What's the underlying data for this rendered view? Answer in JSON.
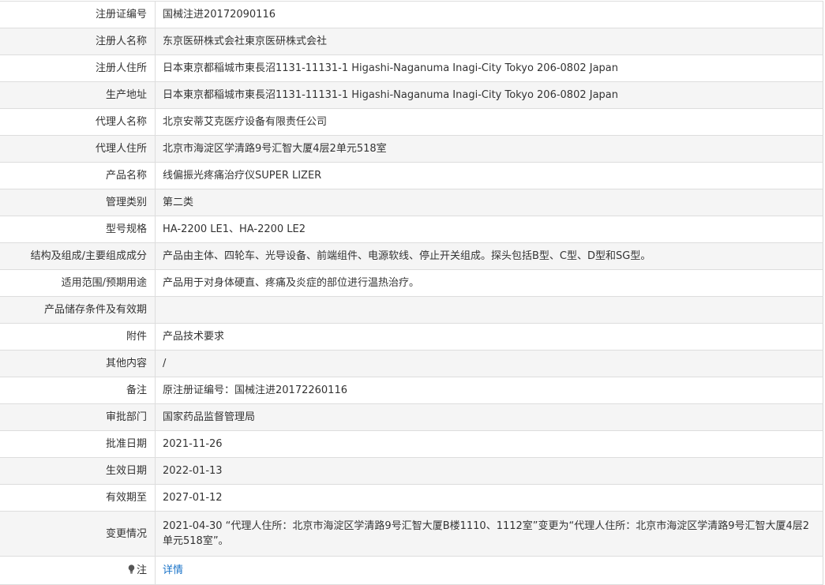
{
  "rows": [
    {
      "label": "注册证编号",
      "value": "国械注进20172090116"
    },
    {
      "label": "注册人名称",
      "value": "东京医研株式会社東京医研株式会社"
    },
    {
      "label": "注册人住所",
      "value": "日本東京都稲城市東長沼1131-11131-1 Higashi-Naganuma Inagi-City Tokyo 206-0802 Japan"
    },
    {
      "label": "生产地址",
      "value": "日本東京都稲城市東長沼1131-11131-1 Higashi-Naganuma Inagi-City Tokyo 206-0802 Japan"
    },
    {
      "label": "代理人名称",
      "value": "北京安蒂艾克医疗设备有限责任公司"
    },
    {
      "label": "代理人住所",
      "value": "北京市海淀区学清路9号汇智大厦4层2单元518室"
    },
    {
      "label": "产品名称",
      "value": "线偏振光疼痛治疗仪SUPER LIZER"
    },
    {
      "label": "管理类别",
      "value": "第二类"
    },
    {
      "label": "型号规格",
      "value": "HA-2200 LE1、HA-2200 LE2"
    },
    {
      "label": "结构及组成/主要组成成分",
      "value": "产品由主体、四轮车、光导设备、前端组件、电源软线、停止开关组成。探头包括B型、C型、D型和SG型。"
    },
    {
      "label": "适用范围/预期用途",
      "value": "产品用于对身体硬直、疼痛及炎症的部位进行温热治疗。"
    },
    {
      "label": "产品储存条件及有效期",
      "value": ""
    },
    {
      "label": "附件",
      "value": "产品技术要求"
    },
    {
      "label": "其他内容",
      "value": "/"
    },
    {
      "label": "备注",
      "value": "原注册证编号：国械注进20172260116"
    },
    {
      "label": "审批部门",
      "value": "国家药品监督管理局"
    },
    {
      "label": "批准日期",
      "value": "2021-11-26"
    },
    {
      "label": "生效日期",
      "value": "2022-01-13"
    },
    {
      "label": "有效期至",
      "value": "2027-01-12"
    },
    {
      "label": "变更情况",
      "value": "2021-04-30 “代理人住所：北京市海淀区学清路9号汇智大厦B楼1110、1112室”变更为“代理人住所：北京市海淀区学清路9号汇智大厦4层2单元518室”。"
    }
  ],
  "note": {
    "icon": "lightbulb-icon",
    "label": "注",
    "link_text": "详情",
    "link_color": "#1a73c8"
  },
  "colors": {
    "stripe": "#f5f5f5",
    "border": "#dddddd",
    "text": "#333333"
  }
}
